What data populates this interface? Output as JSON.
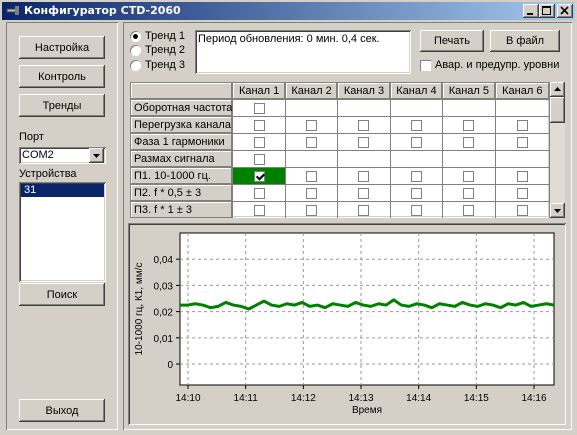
{
  "window": {
    "title": "Конфигуратор СТD-2060"
  },
  "left": {
    "settings_btn": "Настройка",
    "control_btn": "Контроль",
    "trends_btn": "Тренды",
    "port_label": "Порт",
    "port_value": "COM2",
    "devices_label": "Устройства",
    "devices": [
      "31"
    ],
    "search_btn": "Поиск",
    "exit_btn": "Выход"
  },
  "top": {
    "trends": [
      {
        "label": "Тренд 1",
        "selected": true
      },
      {
        "label": "Тренд 2",
        "selected": false
      },
      {
        "label": "Тренд 3",
        "selected": false
      }
    ],
    "period_text": "Период обновления: 0 мин. 0,4 сек.",
    "print_btn": "Печать",
    "file_btn": "В файл",
    "alarm_checkbox": "Авар. и предупр. уровни"
  },
  "grid": {
    "columns": [
      "Канал 1",
      "Канал 2",
      "Канал 3",
      "Канал 4",
      "Канал 5",
      "Канал 6"
    ],
    "rows": [
      {
        "label": "Оборотная частота",
        "cells": [
          false,
          null,
          null,
          null,
          null,
          null
        ]
      },
      {
        "label": "Перегрузка канала",
        "cells": [
          false,
          false,
          false,
          false,
          false,
          false
        ]
      },
      {
        "label": "Фаза 1 гармоники",
        "cells": [
          false,
          false,
          false,
          false,
          false,
          false
        ]
      },
      {
        "label": "Размах сигнала",
        "cells": [
          false,
          null,
          null,
          null,
          null,
          null
        ]
      },
      {
        "label": "П1. 10-1000 гц.",
        "cells": [
          true,
          false,
          false,
          false,
          false,
          false
        ]
      },
      {
        "label": "П2. f * 0,5 ± 3",
        "cells": [
          false,
          false,
          false,
          false,
          false,
          false
        ]
      },
      {
        "label": "П3. f * 1 ± 3",
        "cells": [
          false,
          false,
          false,
          false,
          false,
          false
        ]
      }
    ]
  },
  "colors": {
    "trend": "#008000",
    "selected": "#008000",
    "titlebar": "#0a246a"
  },
  "chart_data": {
    "type": "line",
    "ylabel": "10-1000 гц, К1, мм/с",
    "xlabel": "Время",
    "ylim": [
      -0.008,
      0.05
    ],
    "yticks": [
      "0,04",
      "0,03",
      "0,02",
      "0,01",
      "0"
    ],
    "ytick_values": [
      0.04,
      0.03,
      0.02,
      0.01,
      0
    ],
    "xticks": [
      "14:10",
      "14:11",
      "14:12",
      "14:13",
      "14:14",
      "14:15",
      "14:16"
    ],
    "grid": true,
    "series": [
      {
        "values": [
          0.0225,
          0.0225,
          0.023,
          0.0225,
          0.0215,
          0.022,
          0.0235,
          0.0225,
          0.022,
          0.021,
          0.0225,
          0.024,
          0.0225,
          0.022,
          0.023,
          0.0225,
          0.0235,
          0.022,
          0.0225,
          0.0215,
          0.023,
          0.0225,
          0.022,
          0.0235,
          0.0225,
          0.022,
          0.023,
          0.0225,
          0.0245,
          0.0225,
          0.022,
          0.023,
          0.0225,
          0.0215,
          0.023,
          0.0225,
          0.022,
          0.0235,
          0.0225,
          0.022,
          0.023,
          0.0225,
          0.0215,
          0.023,
          0.0225,
          0.0235,
          0.022,
          0.0225,
          0.023,
          0.0225
        ]
      }
    ]
  }
}
